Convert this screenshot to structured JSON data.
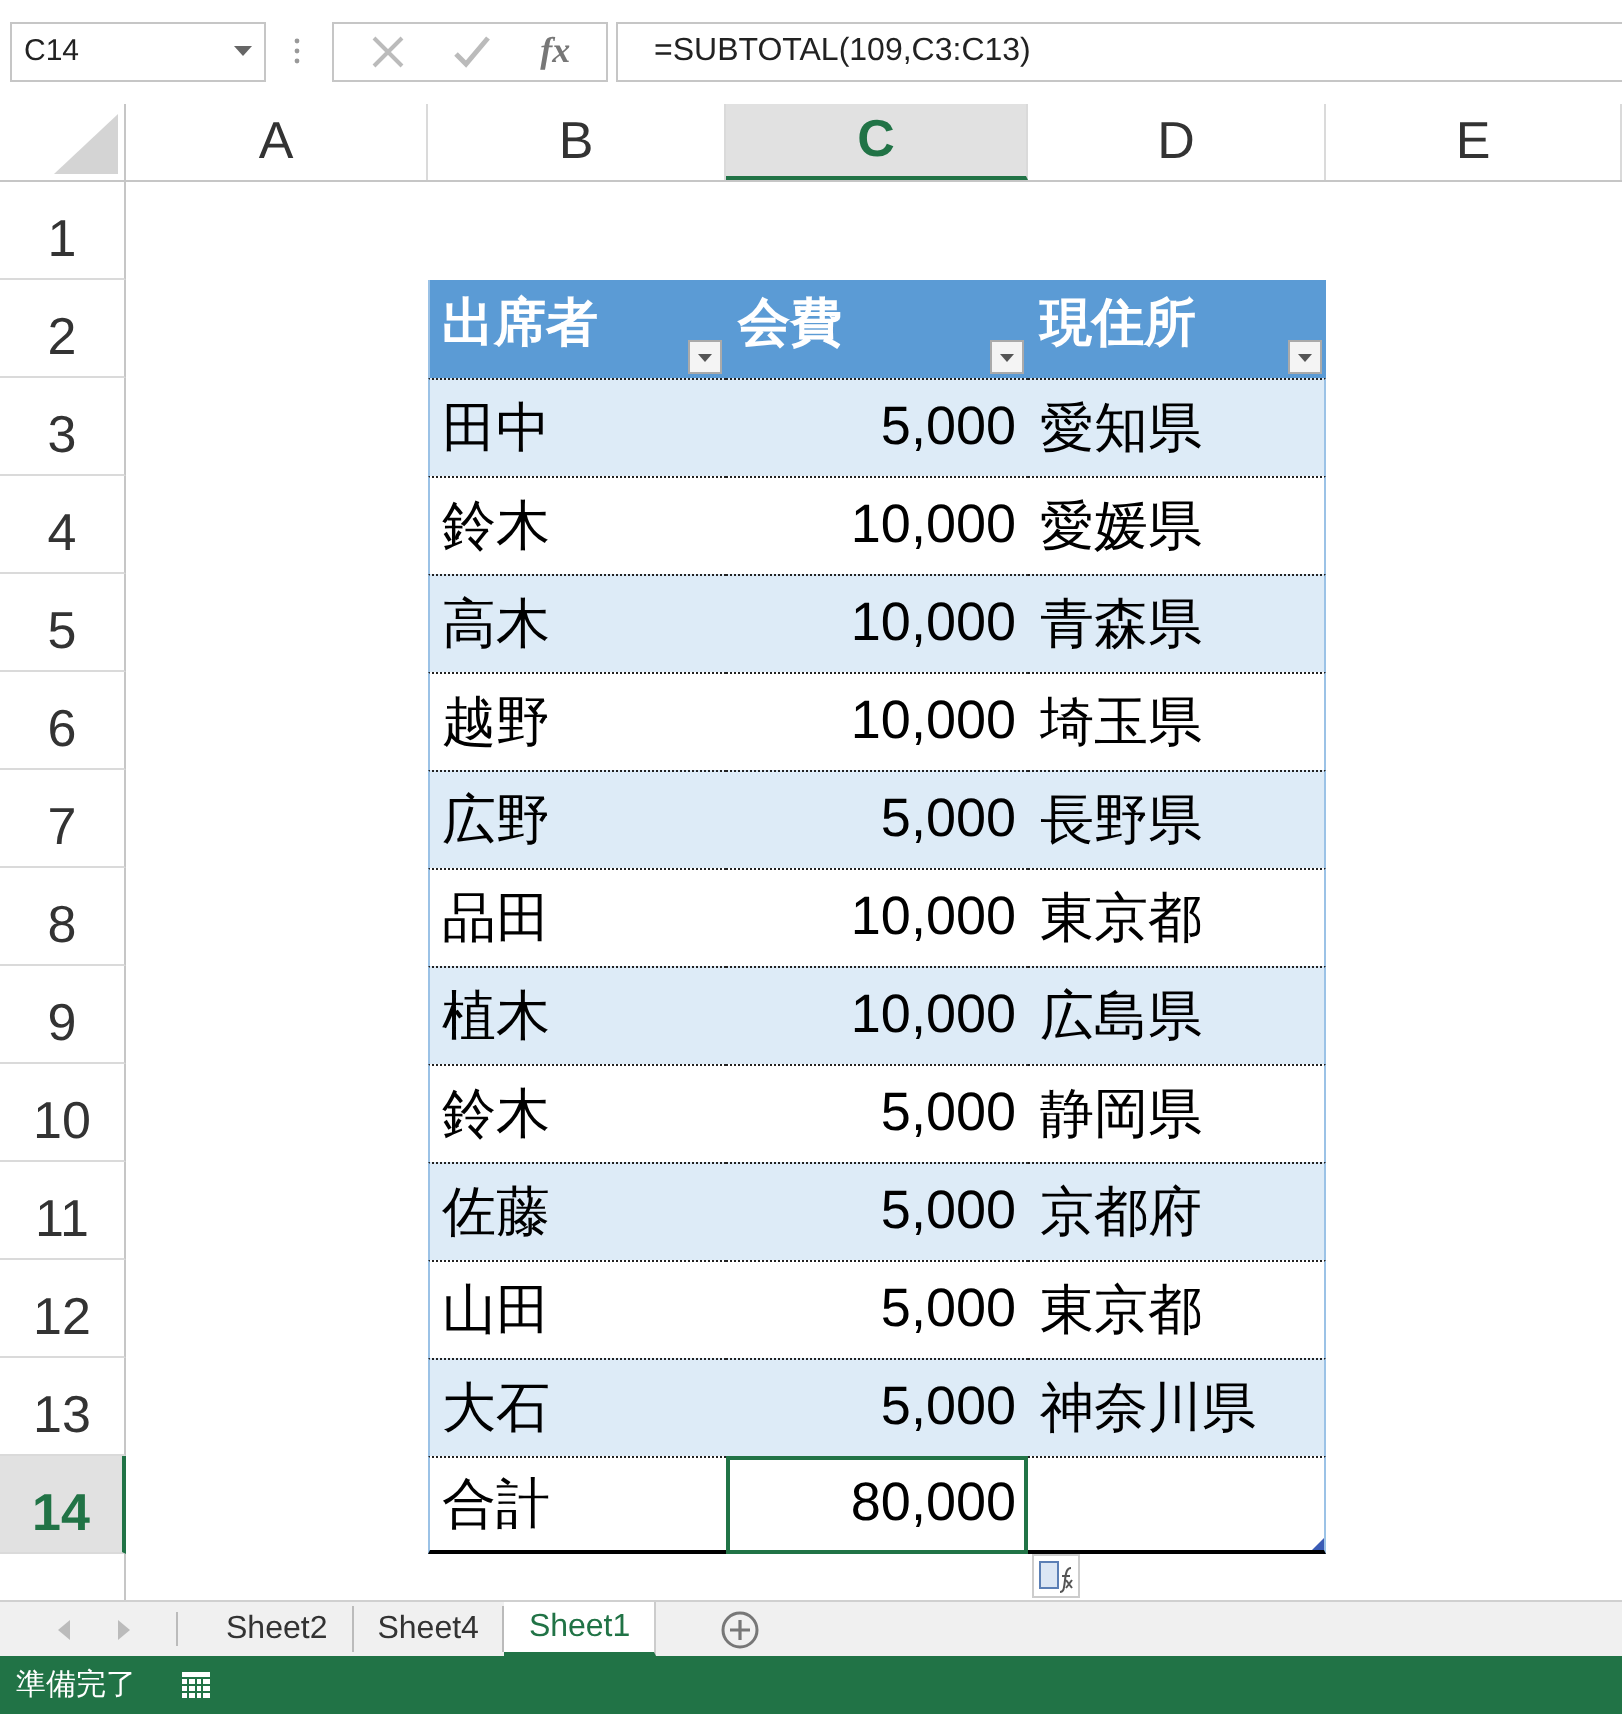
{
  "name_box": "C14",
  "fx": "fx",
  "formula": "=SUBTOTAL(109,C3:C13)",
  "columns": [
    {
      "label": "A",
      "selected": false
    },
    {
      "label": "B",
      "selected": false
    },
    {
      "label": "C",
      "selected": true
    },
    {
      "label": "D",
      "selected": false
    },
    {
      "label": "E",
      "selected": false
    }
  ],
  "rows": [
    {
      "number": "1",
      "selected": false
    },
    {
      "number": "2",
      "selected": false
    },
    {
      "number": "3",
      "selected": false
    },
    {
      "number": "4",
      "selected": false
    },
    {
      "number": "5",
      "selected": false
    },
    {
      "number": "6",
      "selected": false
    },
    {
      "number": "7",
      "selected": false
    },
    {
      "number": "8",
      "selected": false
    },
    {
      "number": "9",
      "selected": false
    },
    {
      "number": "10",
      "selected": false
    },
    {
      "number": "11",
      "selected": false
    },
    {
      "number": "12",
      "selected": false
    },
    {
      "number": "13",
      "selected": false
    },
    {
      "number": "14",
      "selected": true
    }
  ],
  "table": {
    "headers": [
      "出席者",
      "会費",
      "現住所"
    ],
    "rows": [
      {
        "name": "田中",
        "fee": "5,000",
        "place": "愛知県"
      },
      {
        "name": "鈴木",
        "fee": "10,000",
        "place": "愛媛県"
      },
      {
        "name": "高木",
        "fee": "10,000",
        "place": "青森県"
      },
      {
        "name": "越野",
        "fee": "10,000",
        "place": "埼玉県"
      },
      {
        "name": "広野",
        "fee": "5,000",
        "place": "長野県"
      },
      {
        "name": "品田",
        "fee": "10,000",
        "place": "東京都"
      },
      {
        "name": "植木",
        "fee": "10,000",
        "place": "広島県"
      },
      {
        "name": "鈴木",
        "fee": "5,000",
        "place": "静岡県"
      },
      {
        "name": "佐藤",
        "fee": "5,000",
        "place": "京都府"
      },
      {
        "name": "山田",
        "fee": "5,000",
        "place": "東京都"
      },
      {
        "name": "大石",
        "fee": "5,000",
        "place": "神奈川県"
      }
    ],
    "total": {
      "label": "合計",
      "value": "80,000",
      "selected": true
    }
  },
  "sheet_tabs": [
    {
      "label": "Sheet2",
      "selected": false
    },
    {
      "label": "Sheet4",
      "selected": false
    },
    {
      "label": "Sheet1",
      "selected": true
    }
  ],
  "status": "準備完了"
}
